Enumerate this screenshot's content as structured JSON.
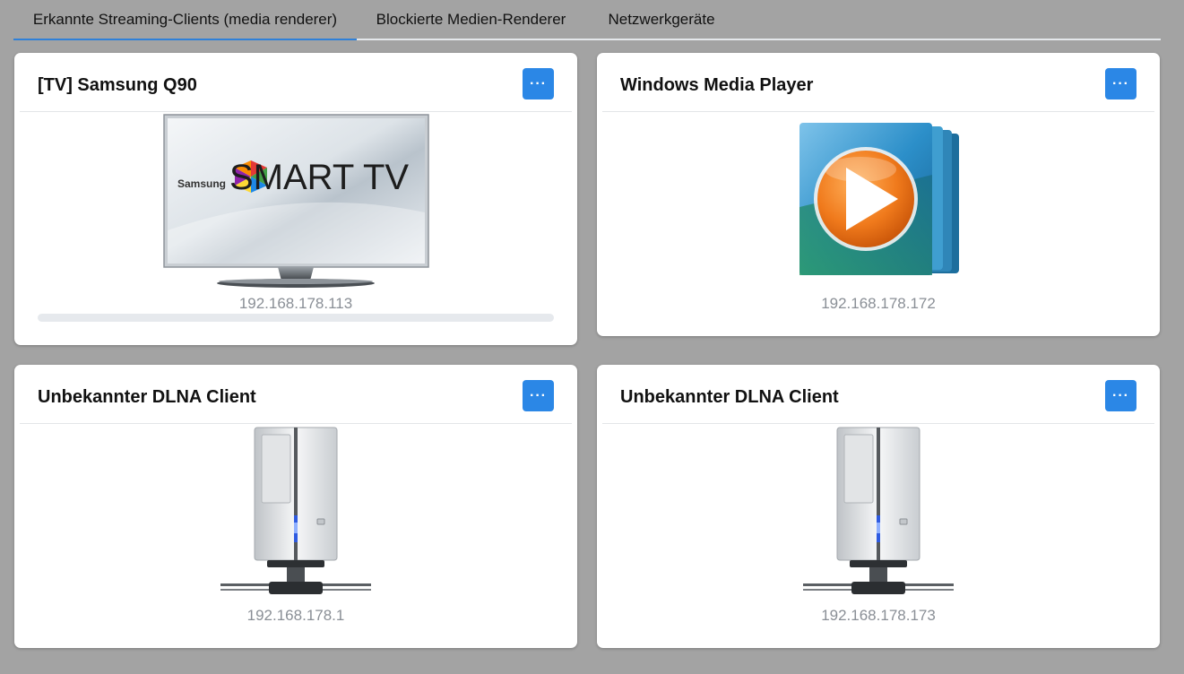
{
  "tabs": [
    {
      "label": "Erkannte Streaming-Clients (media renderer)",
      "active": true
    },
    {
      "label": "Blockierte Medien-Renderer",
      "active": false
    },
    {
      "label": "Netzwerkgeräte",
      "active": false
    }
  ],
  "cards": [
    {
      "title": "[TV] Samsung Q90",
      "icon": "smart-tv-icon",
      "tv_brand": "Samsung",
      "tv_logo": "SMART TV",
      "ip": "192.168.178.113",
      "progress": 0,
      "more_label": "···"
    },
    {
      "title": "Windows Media Player",
      "icon": "media-player-icon",
      "ip": "192.168.178.172",
      "more_label": "···"
    },
    {
      "title": "Unbekannter DLNA Client",
      "icon": "server-tower-icon",
      "ip": "192.168.178.1",
      "more_label": "···"
    },
    {
      "title": "Unbekannter DLNA Client",
      "icon": "server-tower-icon",
      "ip": "192.168.178.173",
      "more_label": "···"
    }
  ],
  "colors": {
    "accent": "#2b87e6",
    "background": "#a3a3a3",
    "ip_text": "#8a8f96"
  }
}
